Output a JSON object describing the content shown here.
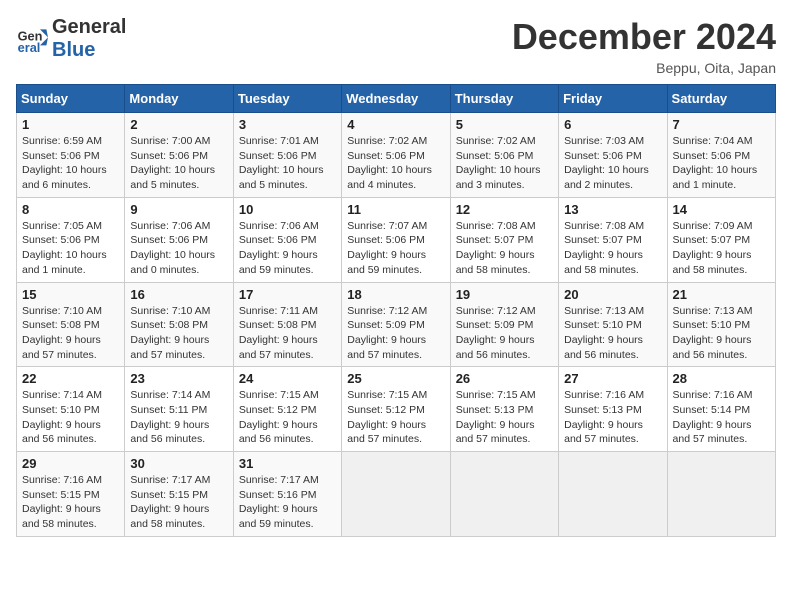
{
  "logo": {
    "line1": "General",
    "line2": "Blue"
  },
  "title": "December 2024",
  "location": "Beppu, Oita, Japan",
  "days_of_week": [
    "Sunday",
    "Monday",
    "Tuesday",
    "Wednesday",
    "Thursday",
    "Friday",
    "Saturday"
  ],
  "weeks": [
    [
      {
        "day": "1",
        "info": "Sunrise: 6:59 AM\nSunset: 5:06 PM\nDaylight: 10 hours\nand 6 minutes."
      },
      {
        "day": "2",
        "info": "Sunrise: 7:00 AM\nSunset: 5:06 PM\nDaylight: 10 hours\nand 5 minutes."
      },
      {
        "day": "3",
        "info": "Sunrise: 7:01 AM\nSunset: 5:06 PM\nDaylight: 10 hours\nand 5 minutes."
      },
      {
        "day": "4",
        "info": "Sunrise: 7:02 AM\nSunset: 5:06 PM\nDaylight: 10 hours\nand 4 minutes."
      },
      {
        "day": "5",
        "info": "Sunrise: 7:02 AM\nSunset: 5:06 PM\nDaylight: 10 hours\nand 3 minutes."
      },
      {
        "day": "6",
        "info": "Sunrise: 7:03 AM\nSunset: 5:06 PM\nDaylight: 10 hours\nand 2 minutes."
      },
      {
        "day": "7",
        "info": "Sunrise: 7:04 AM\nSunset: 5:06 PM\nDaylight: 10 hours\nand 1 minute."
      }
    ],
    [
      {
        "day": "8",
        "info": "Sunrise: 7:05 AM\nSunset: 5:06 PM\nDaylight: 10 hours\nand 1 minute."
      },
      {
        "day": "9",
        "info": "Sunrise: 7:06 AM\nSunset: 5:06 PM\nDaylight: 10 hours\nand 0 minutes."
      },
      {
        "day": "10",
        "info": "Sunrise: 7:06 AM\nSunset: 5:06 PM\nDaylight: 9 hours\nand 59 minutes."
      },
      {
        "day": "11",
        "info": "Sunrise: 7:07 AM\nSunset: 5:06 PM\nDaylight: 9 hours\nand 59 minutes."
      },
      {
        "day": "12",
        "info": "Sunrise: 7:08 AM\nSunset: 5:07 PM\nDaylight: 9 hours\nand 58 minutes."
      },
      {
        "day": "13",
        "info": "Sunrise: 7:08 AM\nSunset: 5:07 PM\nDaylight: 9 hours\nand 58 minutes."
      },
      {
        "day": "14",
        "info": "Sunrise: 7:09 AM\nSunset: 5:07 PM\nDaylight: 9 hours\nand 58 minutes."
      }
    ],
    [
      {
        "day": "15",
        "info": "Sunrise: 7:10 AM\nSunset: 5:08 PM\nDaylight: 9 hours\nand 57 minutes."
      },
      {
        "day": "16",
        "info": "Sunrise: 7:10 AM\nSunset: 5:08 PM\nDaylight: 9 hours\nand 57 minutes."
      },
      {
        "day": "17",
        "info": "Sunrise: 7:11 AM\nSunset: 5:08 PM\nDaylight: 9 hours\nand 57 minutes."
      },
      {
        "day": "18",
        "info": "Sunrise: 7:12 AM\nSunset: 5:09 PM\nDaylight: 9 hours\nand 57 minutes."
      },
      {
        "day": "19",
        "info": "Sunrise: 7:12 AM\nSunset: 5:09 PM\nDaylight: 9 hours\nand 56 minutes."
      },
      {
        "day": "20",
        "info": "Sunrise: 7:13 AM\nSunset: 5:10 PM\nDaylight: 9 hours\nand 56 minutes."
      },
      {
        "day": "21",
        "info": "Sunrise: 7:13 AM\nSunset: 5:10 PM\nDaylight: 9 hours\nand 56 minutes."
      }
    ],
    [
      {
        "day": "22",
        "info": "Sunrise: 7:14 AM\nSunset: 5:10 PM\nDaylight: 9 hours\nand 56 minutes."
      },
      {
        "day": "23",
        "info": "Sunrise: 7:14 AM\nSunset: 5:11 PM\nDaylight: 9 hours\nand 56 minutes."
      },
      {
        "day": "24",
        "info": "Sunrise: 7:15 AM\nSunset: 5:12 PM\nDaylight: 9 hours\nand 56 minutes."
      },
      {
        "day": "25",
        "info": "Sunrise: 7:15 AM\nSunset: 5:12 PM\nDaylight: 9 hours\nand 57 minutes."
      },
      {
        "day": "26",
        "info": "Sunrise: 7:15 AM\nSunset: 5:13 PM\nDaylight: 9 hours\nand 57 minutes."
      },
      {
        "day": "27",
        "info": "Sunrise: 7:16 AM\nSunset: 5:13 PM\nDaylight: 9 hours\nand 57 minutes."
      },
      {
        "day": "28",
        "info": "Sunrise: 7:16 AM\nSunset: 5:14 PM\nDaylight: 9 hours\nand 57 minutes."
      }
    ],
    [
      {
        "day": "29",
        "info": "Sunrise: 7:16 AM\nSunset: 5:15 PM\nDaylight: 9 hours\nand 58 minutes."
      },
      {
        "day": "30",
        "info": "Sunrise: 7:17 AM\nSunset: 5:15 PM\nDaylight: 9 hours\nand 58 minutes."
      },
      {
        "day": "31",
        "info": "Sunrise: 7:17 AM\nSunset: 5:16 PM\nDaylight: 9 hours\nand 59 minutes."
      },
      {
        "day": "",
        "info": ""
      },
      {
        "day": "",
        "info": ""
      },
      {
        "day": "",
        "info": ""
      },
      {
        "day": "",
        "info": ""
      }
    ]
  ]
}
